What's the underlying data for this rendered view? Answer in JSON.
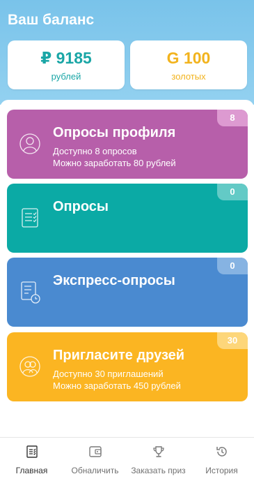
{
  "header": {
    "title": "Ваш баланс"
  },
  "balance": {
    "rubles": {
      "value": "₽ 9185",
      "label": "рублей"
    },
    "gold": {
      "value": "G 100",
      "label": "золотых"
    }
  },
  "tiles": [
    {
      "title": "Опросы профиля",
      "badge": "8",
      "lines": [
        "Доступно 8 опросов",
        "Можно заработать 80 рублей"
      ],
      "icon": "user-icon",
      "color": "#b75faa",
      "badge_color": "#dd9ad1"
    },
    {
      "title": "Опросы",
      "badge": "0",
      "lines": [],
      "icon": "checklist-icon",
      "color": "#0baaa5",
      "badge_color": "#63cac6"
    },
    {
      "title": "Экспресс-опросы",
      "badge": "0",
      "lines": [],
      "icon": "timed-checklist-icon",
      "color": "#4a8ad0",
      "badge_color": "#86b3e2"
    },
    {
      "title": "Пригласите друзей",
      "badge": "30",
      "lines": [
        "Доступно 30 приглашений",
        "Можно заработать 450 рублей"
      ],
      "icon": "friends-icon",
      "color": "#fbb522",
      "badge_color": "#fdd67a"
    }
  ],
  "nav": [
    {
      "label": "Главная",
      "icon": "home-list-icon",
      "active": true
    },
    {
      "label": "Обналичить",
      "icon": "wallet-icon",
      "active": false
    },
    {
      "label": "Заказать приз",
      "icon": "trophy-icon",
      "active": false
    },
    {
      "label": "История",
      "icon": "history-icon",
      "active": false
    }
  ]
}
